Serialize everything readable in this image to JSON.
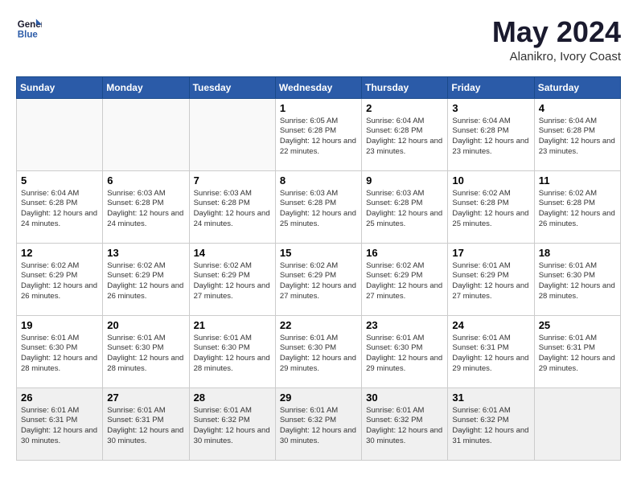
{
  "header": {
    "logo_line1": "General",
    "logo_line2": "Blue",
    "month_year": "May 2024",
    "location": "Alanikro, Ivory Coast"
  },
  "days_of_week": [
    "Sunday",
    "Monday",
    "Tuesday",
    "Wednesday",
    "Thursday",
    "Friday",
    "Saturday"
  ],
  "weeks": [
    [
      {
        "day": "",
        "info": ""
      },
      {
        "day": "",
        "info": ""
      },
      {
        "day": "",
        "info": ""
      },
      {
        "day": "1",
        "info": "Sunrise: 6:05 AM\nSunset: 6:28 PM\nDaylight: 12 hours\nand 22 minutes."
      },
      {
        "day": "2",
        "info": "Sunrise: 6:04 AM\nSunset: 6:28 PM\nDaylight: 12 hours\nand 23 minutes."
      },
      {
        "day": "3",
        "info": "Sunrise: 6:04 AM\nSunset: 6:28 PM\nDaylight: 12 hours\nand 23 minutes."
      },
      {
        "day": "4",
        "info": "Sunrise: 6:04 AM\nSunset: 6:28 PM\nDaylight: 12 hours\nand 23 minutes."
      }
    ],
    [
      {
        "day": "5",
        "info": "Sunrise: 6:04 AM\nSunset: 6:28 PM\nDaylight: 12 hours\nand 24 minutes."
      },
      {
        "day": "6",
        "info": "Sunrise: 6:03 AM\nSunset: 6:28 PM\nDaylight: 12 hours\nand 24 minutes."
      },
      {
        "day": "7",
        "info": "Sunrise: 6:03 AM\nSunset: 6:28 PM\nDaylight: 12 hours\nand 24 minutes."
      },
      {
        "day": "8",
        "info": "Sunrise: 6:03 AM\nSunset: 6:28 PM\nDaylight: 12 hours\nand 25 minutes."
      },
      {
        "day": "9",
        "info": "Sunrise: 6:03 AM\nSunset: 6:28 PM\nDaylight: 12 hours\nand 25 minutes."
      },
      {
        "day": "10",
        "info": "Sunrise: 6:02 AM\nSunset: 6:28 PM\nDaylight: 12 hours\nand 25 minutes."
      },
      {
        "day": "11",
        "info": "Sunrise: 6:02 AM\nSunset: 6:28 PM\nDaylight: 12 hours\nand 26 minutes."
      }
    ],
    [
      {
        "day": "12",
        "info": "Sunrise: 6:02 AM\nSunset: 6:29 PM\nDaylight: 12 hours\nand 26 minutes."
      },
      {
        "day": "13",
        "info": "Sunrise: 6:02 AM\nSunset: 6:29 PM\nDaylight: 12 hours\nand 26 minutes."
      },
      {
        "day": "14",
        "info": "Sunrise: 6:02 AM\nSunset: 6:29 PM\nDaylight: 12 hours\nand 27 minutes."
      },
      {
        "day": "15",
        "info": "Sunrise: 6:02 AM\nSunset: 6:29 PM\nDaylight: 12 hours\nand 27 minutes."
      },
      {
        "day": "16",
        "info": "Sunrise: 6:02 AM\nSunset: 6:29 PM\nDaylight: 12 hours\nand 27 minutes."
      },
      {
        "day": "17",
        "info": "Sunrise: 6:01 AM\nSunset: 6:29 PM\nDaylight: 12 hours\nand 27 minutes."
      },
      {
        "day": "18",
        "info": "Sunrise: 6:01 AM\nSunset: 6:30 PM\nDaylight: 12 hours\nand 28 minutes."
      }
    ],
    [
      {
        "day": "19",
        "info": "Sunrise: 6:01 AM\nSunset: 6:30 PM\nDaylight: 12 hours\nand 28 minutes."
      },
      {
        "day": "20",
        "info": "Sunrise: 6:01 AM\nSunset: 6:30 PM\nDaylight: 12 hours\nand 28 minutes."
      },
      {
        "day": "21",
        "info": "Sunrise: 6:01 AM\nSunset: 6:30 PM\nDaylight: 12 hours\nand 28 minutes."
      },
      {
        "day": "22",
        "info": "Sunrise: 6:01 AM\nSunset: 6:30 PM\nDaylight: 12 hours\nand 29 minutes."
      },
      {
        "day": "23",
        "info": "Sunrise: 6:01 AM\nSunset: 6:30 PM\nDaylight: 12 hours\nand 29 minutes."
      },
      {
        "day": "24",
        "info": "Sunrise: 6:01 AM\nSunset: 6:31 PM\nDaylight: 12 hours\nand 29 minutes."
      },
      {
        "day": "25",
        "info": "Sunrise: 6:01 AM\nSunset: 6:31 PM\nDaylight: 12 hours\nand 29 minutes."
      }
    ],
    [
      {
        "day": "26",
        "info": "Sunrise: 6:01 AM\nSunset: 6:31 PM\nDaylight: 12 hours\nand 30 minutes."
      },
      {
        "day": "27",
        "info": "Sunrise: 6:01 AM\nSunset: 6:31 PM\nDaylight: 12 hours\nand 30 minutes."
      },
      {
        "day": "28",
        "info": "Sunrise: 6:01 AM\nSunset: 6:32 PM\nDaylight: 12 hours\nand 30 minutes."
      },
      {
        "day": "29",
        "info": "Sunrise: 6:01 AM\nSunset: 6:32 PM\nDaylight: 12 hours\nand 30 minutes."
      },
      {
        "day": "30",
        "info": "Sunrise: 6:01 AM\nSunset: 6:32 PM\nDaylight: 12 hours\nand 30 minutes."
      },
      {
        "day": "31",
        "info": "Sunrise: 6:01 AM\nSunset: 6:32 PM\nDaylight: 12 hours\nand 31 minutes."
      },
      {
        "day": "",
        "info": ""
      }
    ]
  ]
}
